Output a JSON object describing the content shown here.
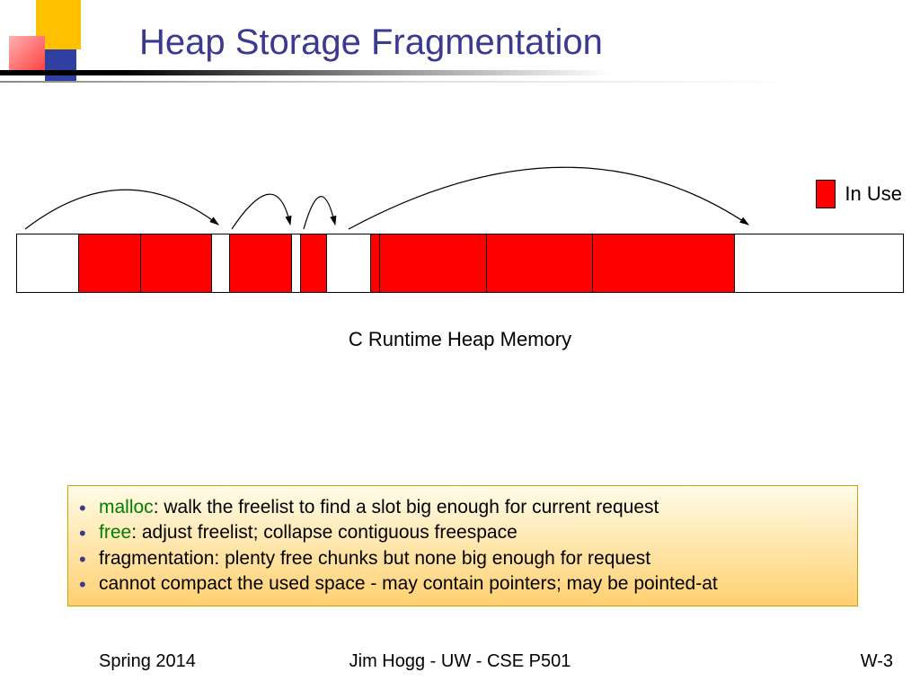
{
  "title": "Heap Storage Fragmentation",
  "legend": {
    "label": "In Use"
  },
  "heap": {
    "caption": "C Runtime Heap Memory",
    "segments": [
      {
        "state": "free",
        "width": 7
      },
      {
        "state": "used",
        "width": 7
      },
      {
        "state": "used",
        "width": 8
      },
      {
        "state": "free",
        "width": 2
      },
      {
        "state": "used",
        "width": 7
      },
      {
        "state": "free",
        "width": 1
      },
      {
        "state": "used",
        "width": 3
      },
      {
        "state": "free",
        "width": 5
      },
      {
        "state": "used",
        "width": 1
      },
      {
        "state": "used",
        "width": 12
      },
      {
        "state": "used",
        "width": 12
      },
      {
        "state": "used",
        "width": 16
      },
      {
        "state": "free",
        "width": 19
      }
    ]
  },
  "notes": {
    "items": [
      {
        "kw": "malloc",
        "rest": ": walk the freelist to find a slot big enough for current request"
      },
      {
        "kw": "free",
        "rest": ": adjust freelist; collapse contiguous freespace"
      },
      {
        "kw": "",
        "rest": "fragmentation: plenty free chunks but none big enough for request"
      },
      {
        "kw": "",
        "rest": "cannot compact the used space - may contain pointers; may be pointed-at"
      }
    ]
  },
  "footer": {
    "left": "Spring 2014",
    "center": "Jim Hogg - UW - CSE P501",
    "right": "W-3"
  }
}
